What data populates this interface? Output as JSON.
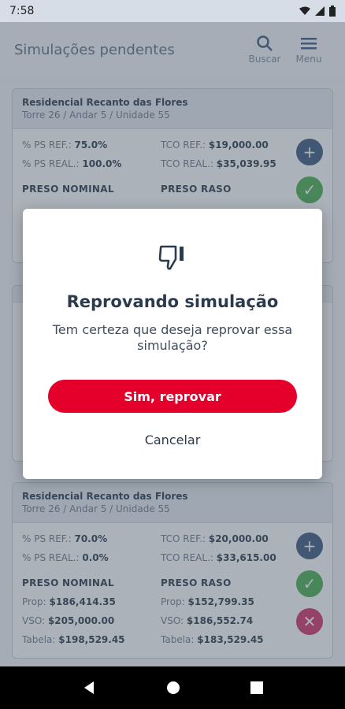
{
  "status_bar": {
    "time": "7:58"
  },
  "header": {
    "title": "Simulações pendentes",
    "search_label": "Buscar",
    "menu_label": "Menu"
  },
  "cards": [
    {
      "name": "Residencial Recanto das Flores",
      "sub": "Torre 26 / Andar 5 / Unidade 55",
      "ps_ref_label": "% PS REF.:",
      "ps_ref": "75.0%",
      "ps_real_label": "% PS REAL.:",
      "ps_real": "100.0%",
      "tco_ref_label": "TCO REF.:",
      "tco_ref": "$19,000.00",
      "tco_real_label": "TCO REAL.:",
      "tco_real": "$35,039.95",
      "nominal_label": "PRESO NOMINAL",
      "raso_label": "PRESO RASO"
    },
    {
      "name": "Residencial Recanto das Flores",
      "sub": "Torre 26 / Andar 5 / Unidade 55",
      "ps_ref_label": "% PS REF.:",
      "ps_ref": "70.0%",
      "ps_real_label": "% PS REAL.:",
      "ps_real": "0.0%",
      "tco_ref_label": "TCO REF.:",
      "tco_ref": "$20,000.00",
      "tco_real_label": "TCO REAL.:",
      "tco_real": "$33,615.00",
      "nominal_label": "PRESO NOMINAL",
      "raso_label": "PRESO RASO",
      "prop_label": "Prop:",
      "prop_nominal": "$186,414.35",
      "prop_raso": "$152,799.35",
      "vso_label": "VSO:",
      "vso_nominal": "$205,000.00",
      "vso_raso": "$186,552.74",
      "tabela_label": "Tabela:",
      "tabela_nominal": "$198,529.45",
      "tabela_raso": "$183,529.45"
    }
  ],
  "dialog": {
    "icon": "thumbs-down-icon",
    "title": "Reprovando simulação",
    "message": "Tem certeza que deseja reprovar essa simulação?",
    "confirm_label": "Sim, reprovar",
    "cancel_label": "Cancelar"
  },
  "colors": {
    "accent_red": "#e5002b",
    "primary_navy": "#2b3b4d"
  }
}
